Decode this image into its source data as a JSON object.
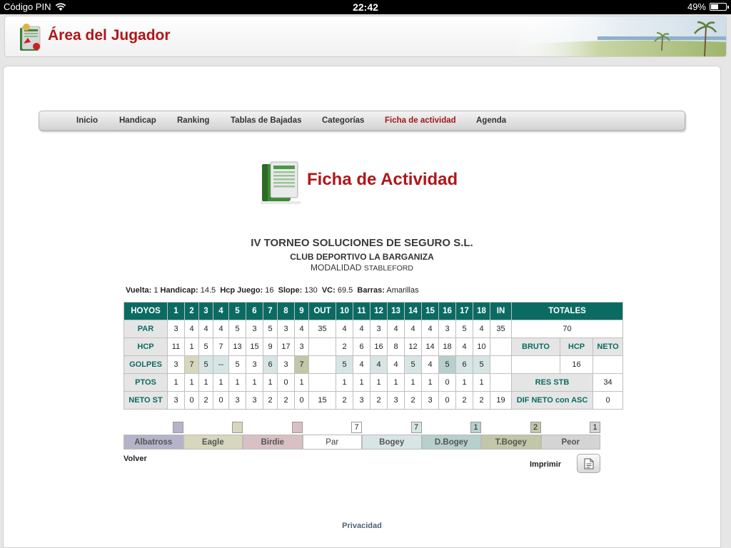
{
  "statusbar": {
    "carrier": "Código PIN",
    "time": "22:42",
    "battery": "49%",
    "battery_level": 0.49
  },
  "header": {
    "title": "Área del Jugador"
  },
  "nav": [
    "Inicio",
    "Handicap",
    "Ranking",
    "Tablas de Bajadas",
    "Categorías",
    "Ficha de actividad",
    "Agenda"
  ],
  "page_title": "Ficha de Actividad",
  "tournament": {
    "name": "IV TORNEO SOLUCIONES DE SEGURO S.L.",
    "club": "CLUB DEPORTIVO LA BARGANIZA",
    "modalidad_label": "MODALIDAD",
    "modalidad_value": "STABLEFORD"
  },
  "info": {
    "vuelta_label": "Vuelta:",
    "vuelta": "1",
    "handicap_label": "Handicap:",
    "handicap": "14.5",
    "hcp_juego_label": "Hcp Juego:",
    "hcp_juego": "16",
    "slope_label": "Slope:",
    "slope": "130",
    "vc_label": "VC:",
    "vc": "69.5",
    "barras_label": "Barras:",
    "barras": "Amarillas"
  },
  "scorecard": {
    "header": [
      "HOYOS",
      "1",
      "2",
      "3",
      "4",
      "5",
      "6",
      "7",
      "8",
      "9",
      "OUT",
      "10",
      "11",
      "12",
      "13",
      "14",
      "15",
      "16",
      "17",
      "18",
      "IN"
    ],
    "totales_label": "TOTALES",
    "par": {
      "label": "PAR",
      "values": [
        "3",
        "4",
        "4",
        "4",
        "5",
        "3",
        "5",
        "3",
        "4",
        "35",
        "4",
        "4",
        "3",
        "4",
        "4",
        "4",
        "3",
        "5",
        "4",
        "35"
      ],
      "total": "70"
    },
    "hcp": {
      "label": "HCP",
      "values": [
        "11",
        "1",
        "5",
        "7",
        "13",
        "15",
        "9",
        "17",
        "3",
        "",
        "2",
        "6",
        "16",
        "8",
        "12",
        "14",
        "18",
        "4",
        "10",
        ""
      ],
      "sub_headers": [
        "BRUTO",
        "HCP",
        "NETO"
      ]
    },
    "golpes": {
      "label": "GOLPES",
      "values": [
        "3",
        "7",
        "5",
        "--",
        "5",
        "3",
        "6",
        "3",
        "7",
        "",
        "5",
        "4",
        "4",
        "4",
        "5",
        "4",
        "5",
        "6",
        "5",
        ""
      ],
      "cell_classes": [
        "",
        "c-eagle",
        "c-bogey",
        "c-bogey",
        "",
        "",
        "c-bogey",
        "",
        "c-tbogey",
        "",
        "c-bogey",
        "",
        "c-bogey",
        "",
        "c-bogey",
        "",
        "c-dbogey",
        "c-bogey",
        "c-bogey",
        ""
      ],
      "totals": [
        "",
        "16",
        ""
      ]
    },
    "ptos": {
      "label": "PTOS",
      "values": [
        "1",
        "1",
        "1",
        "1",
        "1",
        "1",
        "1",
        "0",
        "1",
        "",
        "1",
        "1",
        "1",
        "1",
        "1",
        "1",
        "0",
        "1",
        "1",
        ""
      ],
      "res_label": "RES STB",
      "res_value": "34"
    },
    "neto": {
      "label": "NETO ST",
      "values": [
        "3",
        "0",
        "2",
        "0",
        "3",
        "3",
        "2",
        "2",
        "0",
        "15",
        "2",
        "3",
        "2",
        "3",
        "2",
        "3",
        "0",
        "2",
        "2",
        "19"
      ],
      "dif_label": "DIF NETO con ASC",
      "dif_value": "0"
    }
  },
  "legend": {
    "items": [
      {
        "label": "Albatross",
        "count": "",
        "color": "#b5b3c9"
      },
      {
        "label": "Eagle",
        "count": "",
        "color": "#d6d7bd"
      },
      {
        "label": "Birdie",
        "count": "",
        "color": "#d8c0c4"
      },
      {
        "label": "Par",
        "count": "7",
        "color": "#ffffff"
      },
      {
        "label": "Bogey",
        "count": "7",
        "color": "#d7e5e5"
      },
      {
        "label": "D.Bogey",
        "count": "1",
        "color": "#b7cfcd"
      },
      {
        "label": "T.Bogey",
        "count": "2",
        "color": "#c2c7a8"
      },
      {
        "label": "Peor",
        "count": "1",
        "color": "#d4d4d4"
      }
    ]
  },
  "actions": {
    "volver": "Volver",
    "imprimir": "Imprimir"
  },
  "footer": {
    "privacidad": "Privacidad"
  }
}
